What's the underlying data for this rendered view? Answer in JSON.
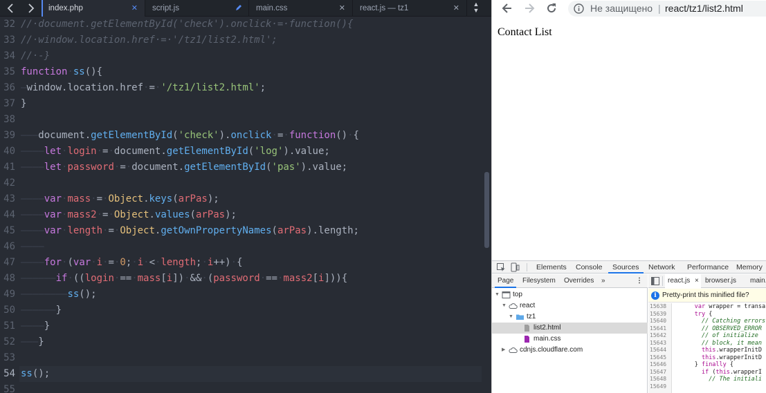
{
  "editor": {
    "tabs": [
      {
        "label": "index.php",
        "active": true,
        "close": "✕"
      },
      {
        "label": "script.js",
        "active": false,
        "close": ""
      },
      {
        "label": "main.css",
        "active": false,
        "close": "✕"
      },
      {
        "label": "react.js — tz1",
        "active": false,
        "close": "✕"
      }
    ],
    "current_line": 54,
    "lines": [
      {
        "n": 32,
        "code": [
          [
            "cm",
            "//·document.getElementById('check').onclick·=·function(){"
          ]
        ]
      },
      {
        "n": 33,
        "code": [
          [
            "cm",
            "//·window.location.href·=·'/tz1/list2.html';"
          ]
        ]
      },
      {
        "n": 34,
        "code": [
          [
            "cm",
            "//·-}"
          ]
        ]
      },
      {
        "n": 35,
        "code": [
          [
            "kw",
            "function"
          ],
          [
            "ws",
            "·"
          ],
          [
            "fn",
            "ss"
          ],
          [
            "",
            "(){"
          ]
        ]
      },
      {
        "n": 36,
        "code": [
          [
            "ws",
            "—"
          ],
          [
            "",
            "window.location.href"
          ],
          [
            "ws",
            "·"
          ],
          [
            "",
            "="
          ],
          [
            "ws",
            "·"
          ],
          [
            "st",
            "'/tz1/list2.html'"
          ],
          [
            "",
            ";"
          ]
        ]
      },
      {
        "n": 37,
        "code": [
          [
            "",
            "}"
          ]
        ]
      },
      {
        "n": 38,
        "code": []
      },
      {
        "n": 39,
        "code": [
          [
            "ws",
            "———"
          ],
          [
            "",
            "document."
          ],
          [
            "fn",
            "getElementById"
          ],
          [
            "",
            "("
          ],
          [
            "st",
            "'check'"
          ],
          [
            "",
            ")."
          ],
          [
            "fn",
            "onclick"
          ],
          [
            "ws",
            "·"
          ],
          [
            "",
            "="
          ],
          [
            "ws",
            "·"
          ],
          [
            "kw",
            "function"
          ],
          [
            "",
            "()"
          ],
          [
            "ws",
            "·"
          ],
          [
            "",
            "{"
          ]
        ]
      },
      {
        "n": 40,
        "code": [
          [
            "ws",
            "————"
          ],
          [
            "kw",
            "let"
          ],
          [
            "ws",
            "·"
          ],
          [
            "vr",
            "login"
          ],
          [
            "ws",
            "·"
          ],
          [
            "",
            "="
          ],
          [
            "ws",
            "·"
          ],
          [
            "",
            "document."
          ],
          [
            "fn",
            "getElementById"
          ],
          [
            "",
            "("
          ],
          [
            "st",
            "'log'"
          ],
          [
            "",
            ").value;"
          ]
        ]
      },
      {
        "n": 41,
        "code": [
          [
            "ws",
            "————"
          ],
          [
            "kw",
            "let"
          ],
          [
            "ws",
            "·"
          ],
          [
            "vr",
            "password"
          ],
          [
            "ws",
            "·"
          ],
          [
            "",
            "="
          ],
          [
            "ws",
            "·"
          ],
          [
            "",
            "document."
          ],
          [
            "fn",
            "getElementById"
          ],
          [
            "",
            "("
          ],
          [
            "st",
            "'pas'"
          ],
          [
            "",
            ").value;"
          ]
        ]
      },
      {
        "n": 42,
        "code": []
      },
      {
        "n": 43,
        "code": [
          [
            "ws",
            "————"
          ],
          [
            "kw",
            "var"
          ],
          [
            "ws",
            "·"
          ],
          [
            "vr",
            "mass"
          ],
          [
            "ws",
            "·"
          ],
          [
            "",
            "="
          ],
          [
            "ws",
            "·"
          ],
          [
            "ob",
            "Object"
          ],
          [
            "",
            "."
          ],
          [
            "fn",
            "keys"
          ],
          [
            "",
            "("
          ],
          [
            "vr",
            "arPas"
          ],
          [
            "",
            ");"
          ]
        ]
      },
      {
        "n": 44,
        "code": [
          [
            "ws",
            "————"
          ],
          [
            "kw",
            "var"
          ],
          [
            "ws",
            "·"
          ],
          [
            "vr",
            "mass2"
          ],
          [
            "ws",
            "·"
          ],
          [
            "",
            "="
          ],
          [
            "ws",
            "·"
          ],
          [
            "ob",
            "Object"
          ],
          [
            "",
            "."
          ],
          [
            "fn",
            "values"
          ],
          [
            "",
            "("
          ],
          [
            "vr",
            "arPas"
          ],
          [
            "",
            ");"
          ]
        ]
      },
      {
        "n": 45,
        "code": [
          [
            "ws",
            "————"
          ],
          [
            "kw",
            "var"
          ],
          [
            "ws",
            "·"
          ],
          [
            "vr",
            "length"
          ],
          [
            "ws",
            "·"
          ],
          [
            "",
            "="
          ],
          [
            "ws",
            "·"
          ],
          [
            "ob",
            "Object"
          ],
          [
            "",
            "."
          ],
          [
            "fn",
            "getOwnPropertyNames"
          ],
          [
            "",
            "("
          ],
          [
            "vr",
            "arPas"
          ],
          [
            "",
            ").length;"
          ]
        ]
      },
      {
        "n": 46,
        "code": [
          [
            "ws",
            "————"
          ]
        ]
      },
      {
        "n": 47,
        "code": [
          [
            "ws",
            "————"
          ],
          [
            "kw",
            "for"
          ],
          [
            "ws",
            "·"
          ],
          [
            "",
            "("
          ],
          [
            "kw",
            "var"
          ],
          [
            "ws",
            "·"
          ],
          [
            "vr",
            "i"
          ],
          [
            "ws",
            "·"
          ],
          [
            "",
            "="
          ],
          [
            "ws",
            "·"
          ],
          [
            "nm",
            "0"
          ],
          [
            "",
            ";"
          ],
          [
            "ws",
            "·"
          ],
          [
            "vr",
            "i"
          ],
          [
            "ws",
            "·"
          ],
          [
            "",
            "<"
          ],
          [
            "ws",
            "·"
          ],
          [
            "vr",
            "length"
          ],
          [
            "",
            ";"
          ],
          [
            "ws",
            "·"
          ],
          [
            "vr",
            "i"
          ],
          [
            "",
            "++)"
          ],
          [
            "ws",
            "·"
          ],
          [
            "",
            "{"
          ]
        ]
      },
      {
        "n": 48,
        "code": [
          [
            "ws",
            "——————"
          ],
          [
            "kw",
            "if"
          ],
          [
            "ws",
            "·"
          ],
          [
            "",
            "(("
          ],
          [
            "vr",
            "login"
          ],
          [
            "ws",
            "·"
          ],
          [
            "",
            "=="
          ],
          [
            "ws",
            "·"
          ],
          [
            "vr",
            "mass"
          ],
          [
            "",
            "["
          ],
          [
            "vr",
            "i"
          ],
          [
            "",
            "])"
          ],
          [
            "ws",
            "·"
          ],
          [
            "",
            "&&"
          ],
          [
            "ws",
            "·"
          ],
          [
            "",
            "("
          ],
          [
            "vr",
            "password"
          ],
          [
            "ws",
            "·"
          ],
          [
            "",
            "=="
          ],
          [
            "ws",
            "·"
          ],
          [
            "vr",
            "mass2"
          ],
          [
            "",
            "["
          ],
          [
            "vr",
            "i"
          ],
          [
            "",
            "])){"
          ]
        ]
      },
      {
        "n": 49,
        "code": [
          [
            "ws",
            "————————"
          ],
          [
            "fn",
            "ss"
          ],
          [
            "",
            "();"
          ]
        ]
      },
      {
        "n": 50,
        "code": [
          [
            "ws",
            "——————"
          ],
          [
            "",
            "}"
          ]
        ]
      },
      {
        "n": 51,
        "code": [
          [
            "ws",
            "————"
          ],
          [
            "",
            "}"
          ]
        ]
      },
      {
        "n": 52,
        "code": [
          [
            "ws",
            "———"
          ],
          [
            "",
            "}"
          ]
        ]
      },
      {
        "n": 53,
        "code": []
      },
      {
        "n": 54,
        "code": [
          [
            "fn",
            "ss"
          ],
          [
            "",
            "();"
          ]
        ]
      },
      {
        "n": 55,
        "code": []
      }
    ]
  },
  "browser": {
    "security_label": "Не защищено",
    "separator": "|",
    "url": "react/tz1/list2.html",
    "page_text": "Contact List"
  },
  "devtools": {
    "main_tabs": [
      {
        "label": "Elements",
        "active": false
      },
      {
        "label": "Console",
        "active": false
      },
      {
        "label": "Sources",
        "active": true
      },
      {
        "label": "Network",
        "active": false
      },
      {
        "label": "Performance",
        "active": false
      },
      {
        "label": "Memory",
        "active": false
      }
    ],
    "nav_tabs": [
      {
        "label": "Page",
        "active": true
      },
      {
        "label": "Filesystem",
        "active": false
      },
      {
        "label": "Overrides",
        "active": false
      },
      {
        "label": "»",
        "active": false
      }
    ],
    "tree": [
      {
        "label": "top",
        "depth": 0,
        "arrow": "▼",
        "icon": "frame-icon"
      },
      {
        "label": "react",
        "depth": 1,
        "arrow": "▼",
        "icon": "cloud-icon"
      },
      {
        "label": "tz1",
        "depth": 2,
        "arrow": "▼",
        "icon": "folder-icon"
      },
      {
        "label": "list2.html",
        "depth": 3,
        "arrow": "",
        "icon": "file-icon",
        "selected": true
      },
      {
        "label": "main.css",
        "depth": 3,
        "arrow": "",
        "icon": "css-file-icon"
      },
      {
        "label": "cdnjs.cloudflare.com",
        "depth": 1,
        "arrow": "▶",
        "icon": "cloud-icon"
      }
    ],
    "source_tabs": [
      {
        "label": "react.js",
        "active": true,
        "close": "×"
      },
      {
        "label": "browser.js",
        "active": false,
        "close": ""
      },
      {
        "label": "main.",
        "active": false,
        "close": ""
      }
    ],
    "pretty_print_notice": "Pretty-print this minified file?",
    "source_lines": [
      {
        "n": "15638",
        "code": [
          [
            "",
            "      "
          ],
          [
            "skw",
            "var"
          ],
          [
            "",
            " wrapper = transa"
          ]
        ]
      },
      {
        "n": "15639",
        "code": [
          [
            "",
            "      "
          ],
          [
            "skw",
            "try"
          ],
          [
            "",
            " {"
          ]
        ]
      },
      {
        "n": "15640",
        "code": [
          [
            "",
            "        "
          ],
          [
            "scm",
            "// Catching errors"
          ]
        ]
      },
      {
        "n": "15641",
        "code": [
          [
            "",
            "        "
          ],
          [
            "scm",
            "// OBSERVED_ERROR"
          ]
        ]
      },
      {
        "n": "15642",
        "code": [
          [
            "",
            "        "
          ],
          [
            "scm",
            "// of initialize"
          ]
        ]
      },
      {
        "n": "15643",
        "code": [
          [
            "",
            "        "
          ],
          [
            "scm",
            "// block, it mean"
          ]
        ]
      },
      {
        "n": "15644",
        "code": [
          [
            "",
            "        "
          ],
          [
            "skw",
            "this"
          ],
          [
            "",
            ".wrapperInitD"
          ]
        ]
      },
      {
        "n": "15645",
        "code": [
          [
            "",
            "        "
          ],
          [
            "skw",
            "this"
          ],
          [
            "",
            ".wrapperInitD"
          ]
        ]
      },
      {
        "n": "15646",
        "code": [
          [
            "",
            "      } "
          ],
          [
            "skw",
            "finally"
          ],
          [
            "",
            " {"
          ]
        ]
      },
      {
        "n": "15647",
        "code": [
          [
            "",
            "        "
          ],
          [
            "skw",
            "if"
          ],
          [
            "",
            " ("
          ],
          [
            "skw",
            "this"
          ],
          [
            "",
            ".wrapperI"
          ]
        ]
      },
      {
        "n": "15648",
        "code": [
          [
            "",
            "          "
          ],
          [
            "scm",
            "// The initiali"
          ]
        ]
      },
      {
        "n": "15649",
        "code": [
          [
            "",
            ""
          ]
        ]
      }
    ]
  }
}
